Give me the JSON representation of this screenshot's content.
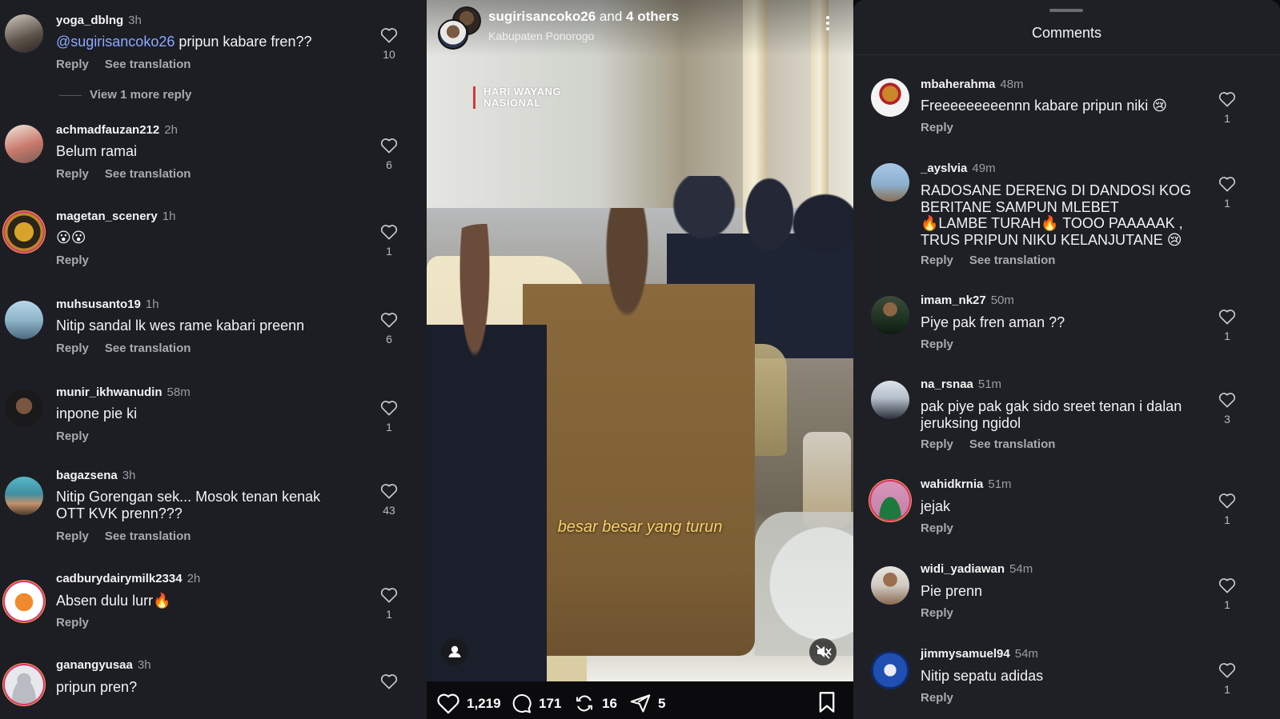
{
  "left_comments": [
    {
      "user": "yoga_dblng",
      "time": "3h",
      "mention": "@sugirisancoko26",
      "text": " pripun kabare fren??",
      "reply": "Reply",
      "translate": "See translation",
      "likes": "10",
      "view_more": "View 1 more reply"
    },
    {
      "user": "achmadfauzan212",
      "time": "2h",
      "text": "Belum ramai",
      "reply": "Reply",
      "translate": "See translation",
      "likes": "6"
    },
    {
      "user": "magetan_scenery",
      "time": "1h",
      "text": "😮😮",
      "reply": "Reply",
      "likes": "1"
    },
    {
      "user": "muhsusanto19",
      "time": "1h",
      "text": "Nitip sandal lk wes rame kabari preenn",
      "reply": "Reply",
      "translate": "See translation",
      "likes": "6"
    },
    {
      "user": "munir_ikhwanudin",
      "time": "58m",
      "text": "inpone pie ki",
      "reply": "Reply",
      "likes": "1"
    },
    {
      "user": "bagazsena",
      "time": "3h",
      "text": "Nitip Gorengan sek... Mosok tenan kenak\nOTT KVK prenn???",
      "reply": "Reply",
      "translate": "See translation",
      "likes": "43"
    },
    {
      "user": "cadburydairymilk2334",
      "time": "2h",
      "text": "Absen dulu lurr🔥",
      "reply": "Reply",
      "likes": "1"
    },
    {
      "user": "ganangyusaa",
      "time": "3h",
      "text": "pripun pren?"
    }
  ],
  "video": {
    "user": "sugirisancoko26",
    "and": "and",
    "others": "4 others",
    "location": "Kabupaten Ponorogo",
    "stamp_line1": "HARI WAYANG",
    "stamp_line2": "NASIONAL",
    "caption": "besar besar yang turun",
    "likes": "1,219",
    "comments": "171",
    "reposts": "16",
    "shares": "5"
  },
  "right": {
    "title": "Comments",
    "comments": [
      {
        "user": "mbaherahma",
        "time": "48m",
        "text": "Freeeeeeeeennn kabare pripun niki 😢",
        "reply": "Reply",
        "likes": "1"
      },
      {
        "user": "_ayslvia",
        "time": "49m",
        "text": "RADOSANE DERENG DI DANDOSI KOG\nBERITANE SAMPUN MLEBET\n🔥LAMBE TURAH🔥 TOOO PAAAAAK ,\nTRUS PRIPUN NIKU KELANJUTANE 😢",
        "reply": "Reply",
        "translate": "See translation",
        "likes": "1"
      },
      {
        "user": "imam_nk27",
        "time": "50m",
        "text": "Piye pak fren aman ??",
        "reply": "Reply",
        "likes": "1"
      },
      {
        "user": "na_rsnaa",
        "time": "51m",
        "text": "pak piye pak gak sido sreet tenan i dalan\njeruksing ngidol",
        "reply": "Reply",
        "translate": "See translation",
        "likes": "3"
      },
      {
        "user": "wahidkrnia",
        "time": "51m",
        "text": "jejak",
        "reply": "Reply",
        "likes": "1"
      },
      {
        "user": "widi_yadiawan",
        "time": "54m",
        "text": "Pie prenn",
        "reply": "Reply",
        "likes": "1"
      },
      {
        "user": "jimmysamuel94",
        "time": "54m",
        "text": "Nitip sepatu adidas",
        "reply": "Reply",
        "likes": "1"
      }
    ]
  },
  "colors": {
    "panel_bg": "#1c1e24",
    "mention": "#8ea8ff",
    "caption": "#f6cf6a",
    "stamp_bar": "#d23a3a"
  }
}
